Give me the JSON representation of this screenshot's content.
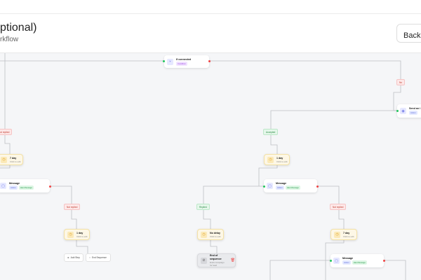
{
  "header": {
    "title": "ptional)",
    "subtitle": "rkflow",
    "back_label": "Back"
  },
  "nodes": {
    "if_connected": {
      "title": "If connected",
      "chip": "Condition",
      "icon": "branch-icon"
    },
    "send_invite": {
      "title": "Send an i",
      "chip": "Action",
      "icon": "send-icon"
    },
    "wait_left": {
      "title": "7 day",
      "sub": "Click to edit"
    },
    "msg_left": {
      "title": "Message",
      "chips": [
        "Action",
        "Has Message"
      ]
    },
    "wait_left2": {
      "title": "1 day",
      "sub": "Click to edit"
    },
    "wait_mid": {
      "title": "1 day",
      "sub": "Click to edit"
    },
    "msg_mid": {
      "title": "Message",
      "chips": [
        "Action",
        "Has Message"
      ]
    },
    "no_delay": {
      "title": "No delay",
      "sub": "Click to edit"
    },
    "end_seq": {
      "title": "End of sequence",
      "sub": "Ends campaign for lead"
    },
    "wait_right": {
      "title": "7 day",
      "sub": "Click to edit"
    },
    "msg_right": {
      "title": "Message",
      "chips": [
        "Action",
        "Has Message"
      ]
    }
  },
  "labels": {
    "no": "No",
    "not_replied": "Not replied",
    "accepted": "Accepted",
    "replied": "Replied"
  },
  "actions": {
    "add_step": "Add Step",
    "end_sequence": "End Sequence"
  },
  "colors": {
    "success": "#22c55e",
    "danger": "#ef4444",
    "wait": "#fdf7e6",
    "canvas": "#f5f6f8"
  }
}
